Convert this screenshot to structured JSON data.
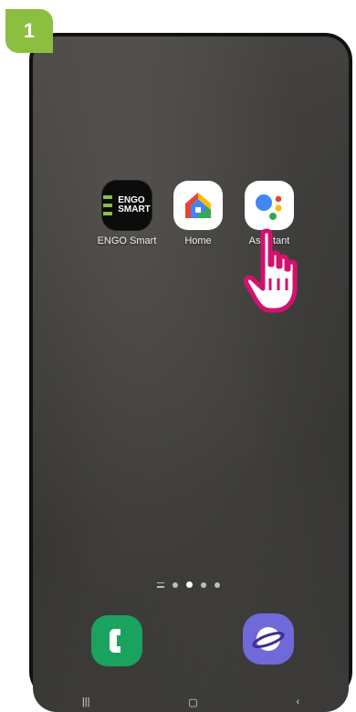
{
  "step": {
    "number": "1"
  },
  "apps": {
    "engo": {
      "label": "ENGO Smart",
      "icon_line1": "ENGO",
      "icon_line2": "SMART"
    },
    "home": {
      "label": "Home"
    },
    "assistant": {
      "label": "Assistant"
    }
  },
  "page_indicator": {
    "count": 5,
    "active_index": 2
  },
  "dock": {
    "phone": "phone-icon",
    "internet": "samsung-internet-icon"
  },
  "colors": {
    "step_badge": "#8cbe3f",
    "hand": "#d4116e",
    "phone_app": "#1aa35e",
    "internet_app": "#6f6ad8"
  }
}
